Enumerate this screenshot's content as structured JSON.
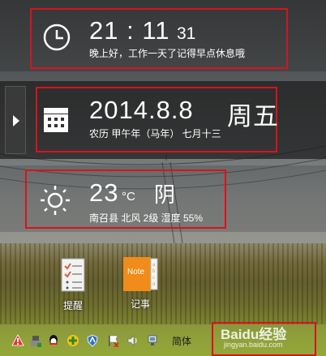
{
  "clock": {
    "time": "21 : 11",
    "seconds": "31",
    "greeting": "晚上好，工作一天了记得早点休息哦"
  },
  "date": {
    "date": "2014.8.8",
    "weekday": "周五",
    "lunar": "农历 甲午年（马年） 七月十三"
  },
  "weather": {
    "temperature": "23",
    "unit": "°C",
    "condition": "阴",
    "details": "南召县 北风 2级 湿度 55%"
  },
  "desktop_icons": [
    {
      "label": "提醒",
      "icon": "reminder-icon"
    },
    {
      "label": "记事",
      "icon": "notes-icon",
      "badge": "Note"
    }
  ],
  "taskbar": {
    "ime_label": "简体",
    "tray_icons": [
      "warning-icon",
      "usb-icon",
      "qq-icon",
      "security-icon",
      "shield-icon",
      "flag-icon",
      "volume-icon",
      "network-icon"
    ]
  },
  "watermark": {
    "brand": "Baidu",
    "brand_cn": "经验",
    "url": "jingyan.baidu.com"
  },
  "colors": {
    "highlight": "#d8131a",
    "panel_dark": "#1c1c1c"
  }
}
